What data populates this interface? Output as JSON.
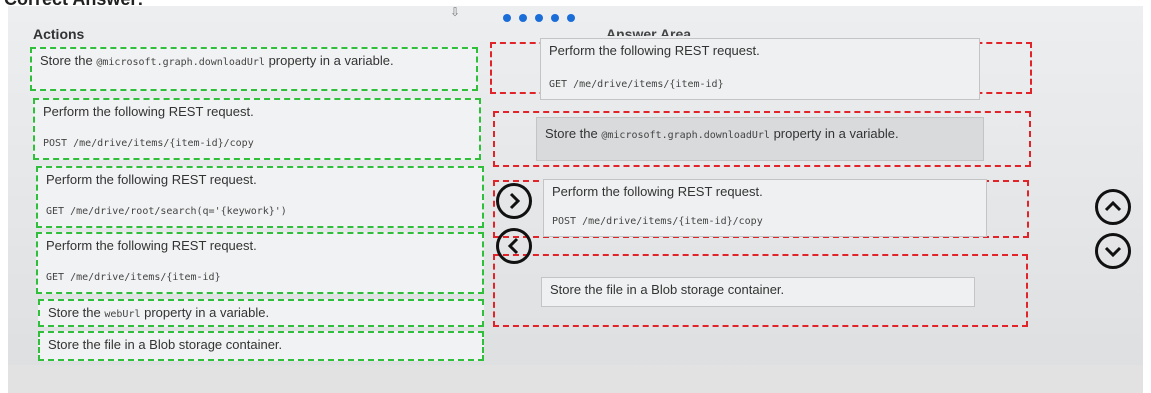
{
  "header": {
    "title": "Correct Answer:",
    "actions_title": "Actions",
    "answer_area_title": "Answer Area",
    "step_count": 5
  },
  "actions": [
    {
      "label_pre": "Store the ",
      "code": "@microsoft.graph.downloadUrl",
      "label_post": " property in a variable."
    },
    {
      "label": "Perform the following REST request.",
      "request": "POST /me/drive/items/{item-id}/copy"
    },
    {
      "label": "Perform the following REST request.",
      "request": "GET /me/drive/root/search(q='{keywork}')"
    },
    {
      "label": "Perform the following REST request.",
      "request": "GET /me/drive/items/{item-id}"
    },
    {
      "label_pre": "Store the ",
      "code": "webUrl",
      "label_post": " property in a variable."
    },
    {
      "label": "Store the file in a Blob storage container."
    }
  ],
  "answers": [
    {
      "label": "Perform the following REST request.",
      "request": "GET /me/drive/items/{item-id}"
    },
    {
      "label_pre": "Store the ",
      "code": "@microsoft.graph.downloadUrl",
      "label_post": " property in a variable."
    },
    {
      "label": "Perform the following REST request.",
      "request": "POST /me/drive/items/{item-id}/copy"
    },
    {
      "label": "Store the file in a Blob storage container."
    }
  ],
  "icons": {
    "move_right": "chevron-right-icon",
    "move_left": "chevron-left-icon",
    "move_up": "chevron-up-icon",
    "move_down": "chevron-down-icon"
  },
  "colors": {
    "source_border": "#2fbf3a",
    "target_border": "#e0242a",
    "progress_dot": "#1b6ed8"
  }
}
